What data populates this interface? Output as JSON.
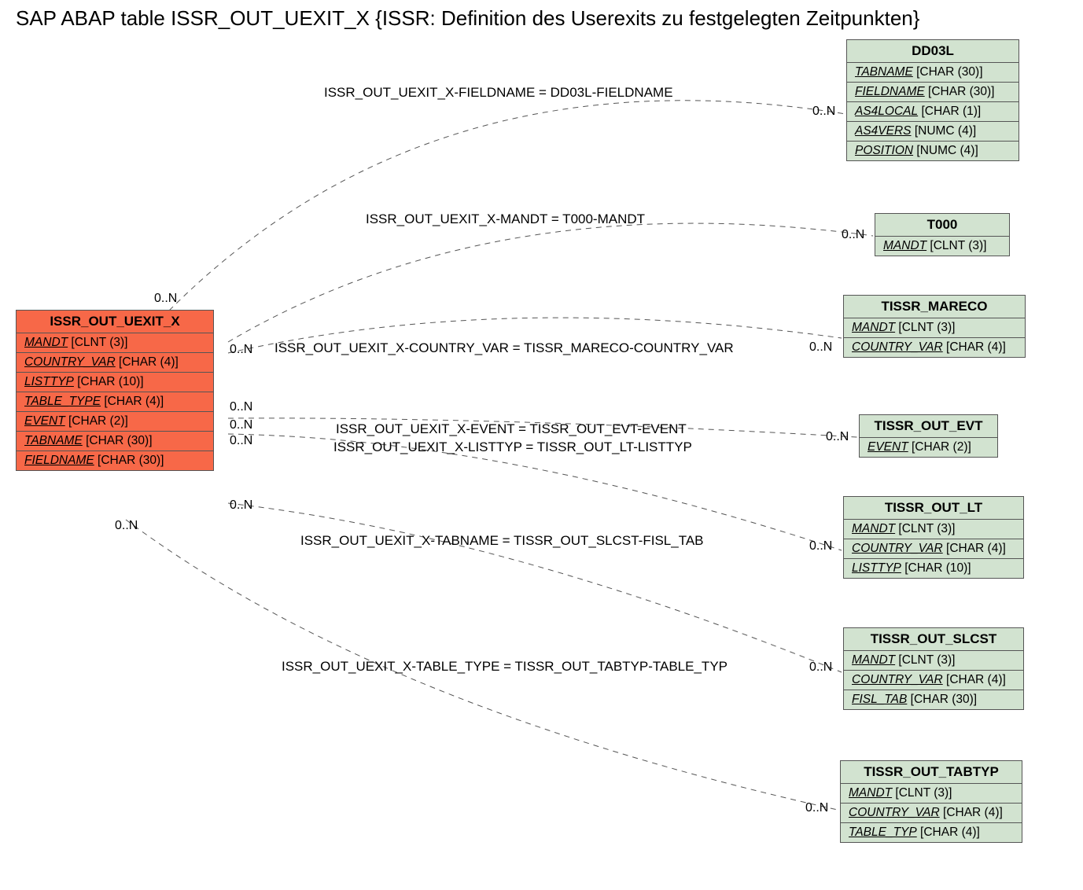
{
  "title": "SAP ABAP table ISSR_OUT_UEXIT_X {ISSR: Definition des Userexits zu festgelegten Zeitpunkten}",
  "source": {
    "name": "ISSR_OUT_UEXIT_X",
    "fields": [
      {
        "name": "MANDT",
        "type": "[CLNT (3)]",
        "key": true
      },
      {
        "name": "COUNTRY_VAR",
        "type": "[CHAR (4)]",
        "key": true
      },
      {
        "name": "LISTTYP",
        "type": "[CHAR (10)]",
        "key": true
      },
      {
        "name": "TABLE_TYPE",
        "type": "[CHAR (4)]",
        "key": true
      },
      {
        "name": "EVENT",
        "type": "[CHAR (2)]",
        "key": true
      },
      {
        "name": "TABNAME",
        "type": "[CHAR (30)]",
        "key": true
      },
      {
        "name": "FIELDNAME",
        "type": "[CHAR (30)]",
        "key": true
      }
    ]
  },
  "targets": {
    "dd03l": {
      "name": "DD03L",
      "fields": [
        {
          "name": "TABNAME",
          "type": "[CHAR (30)]",
          "key": true
        },
        {
          "name": "FIELDNAME",
          "type": "[CHAR (30)]",
          "key": true
        },
        {
          "name": "AS4LOCAL",
          "type": "[CHAR (1)]",
          "key": true
        },
        {
          "name": "AS4VERS",
          "type": "[NUMC (4)]",
          "key": true
        },
        {
          "name": "POSITION",
          "type": "[NUMC (4)]",
          "key": true
        }
      ]
    },
    "t000": {
      "name": "T000",
      "fields": [
        {
          "name": "MANDT",
          "type": "[CLNT (3)]",
          "key": true
        }
      ]
    },
    "tissr_mareco": {
      "name": "TISSR_MARECO",
      "fields": [
        {
          "name": "MANDT",
          "type": "[CLNT (3)]",
          "key": true
        },
        {
          "name": "COUNTRY_VAR",
          "type": "[CHAR (4)]",
          "key": true
        }
      ]
    },
    "tissr_out_evt": {
      "name": "TISSR_OUT_EVT",
      "fields": [
        {
          "name": "EVENT",
          "type": "[CHAR (2)]",
          "key": true
        }
      ]
    },
    "tissr_out_lt": {
      "name": "TISSR_OUT_LT",
      "fields": [
        {
          "name": "MANDT",
          "type": "[CLNT (3)]",
          "key": true
        },
        {
          "name": "COUNTRY_VAR",
          "type": "[CHAR (4)]",
          "key": true
        },
        {
          "name": "LISTTYP",
          "type": "[CHAR (10)]",
          "key": true
        }
      ]
    },
    "tissr_out_slcst": {
      "name": "TISSR_OUT_SLCST",
      "fields": [
        {
          "name": "MANDT",
          "type": "[CLNT (3)]",
          "key": true
        },
        {
          "name": "COUNTRY_VAR",
          "type": "[CHAR (4)]",
          "key": true
        },
        {
          "name": "FISL_TAB",
          "type": "[CHAR (30)]",
          "key": true
        }
      ]
    },
    "tissr_out_tabtyp": {
      "name": "TISSR_OUT_TABTYP",
      "fields": [
        {
          "name": "MANDT",
          "type": "[CLNT (3)]",
          "key": true
        },
        {
          "name": "COUNTRY_VAR",
          "type": "[CHAR (4)]",
          "key": true
        },
        {
          "name": "TABLE_TYP",
          "type": "[CHAR (4)]",
          "key": true
        }
      ]
    }
  },
  "relations": {
    "r1": "ISSR_OUT_UEXIT_X-FIELDNAME = DD03L-FIELDNAME",
    "r2": "ISSR_OUT_UEXIT_X-MANDT = T000-MANDT",
    "r3": "ISSR_OUT_UEXIT_X-COUNTRY_VAR = TISSR_MARECO-COUNTRY_VAR",
    "r4": "ISSR_OUT_UEXIT_X-EVENT = TISSR_OUT_EVT-EVENT",
    "r5": "ISSR_OUT_UEXIT_X-LISTTYP = TISSR_OUT_LT-LISTTYP",
    "r6": "ISSR_OUT_UEXIT_X-TABNAME = TISSR_OUT_SLCST-FISL_TAB",
    "r7": "ISSR_OUT_UEXIT_X-TABLE_TYPE = TISSR_OUT_TABTYP-TABLE_TYP"
  },
  "card": "0..N"
}
